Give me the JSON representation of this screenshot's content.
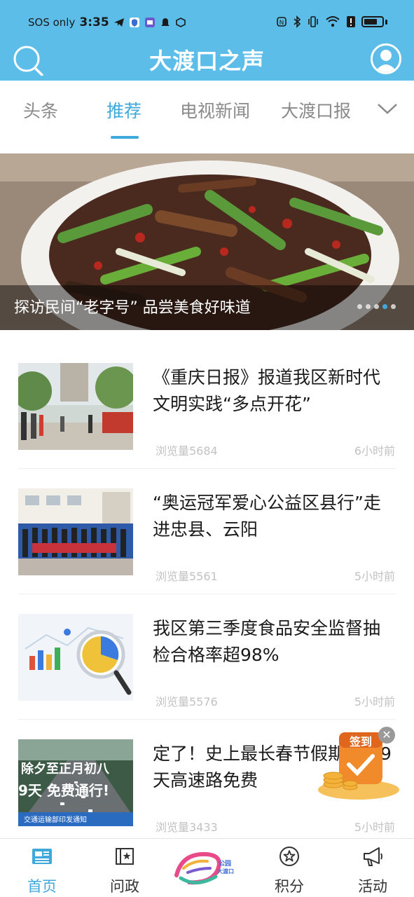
{
  "status_bar": {
    "carrier": "SOS only",
    "time": "3:35"
  },
  "header": {
    "title": "大渡口之声",
    "bg_color": "#5cbde9"
  },
  "tabs": {
    "items": [
      {
        "label": "头条",
        "active": false
      },
      {
        "label": "推荐",
        "active": true
      },
      {
        "label": "电视新闻",
        "active": false
      },
      {
        "label": "大渡口报",
        "active": false
      }
    ],
    "accent_color": "#3fa9dc"
  },
  "banner": {
    "caption": "探访民间“老字号” 品尝美食好味道",
    "slide_count": 5,
    "active_slide": 4
  },
  "news": [
    {
      "title": "《重庆日报》报道我区新时代文明实践“多点开花”",
      "views": "浏览量5684",
      "time": "6小时前",
      "thumb": "street-event-photo"
    },
    {
      "title": "“奥运冠军爱心公益区县行”走进忠县、云阳",
      "views": "浏览量5561",
      "time": "5小时前",
      "thumb": "group-photo"
    },
    {
      "title": "我区第三季度食品安全监督抽检合格率超98%",
      "views": "浏览量5576",
      "time": "5小时前",
      "thumb": "chart-magnifier-illustration"
    },
    {
      "title": "定了！史上最长春节假期连续9天高速路免费",
      "views": "浏览量3433",
      "time": "5小时前",
      "thumb": "highway-photo"
    }
  ],
  "news4_thumb_text": {
    "line1": "除夕至正月初八",
    "line2": "9天 免费通行!",
    "footer": "交通运输部印发通知"
  },
  "signin": {
    "label": "签到"
  },
  "bottom_nav": [
    {
      "label": "首页",
      "icon": "news-icon",
      "active": true
    },
    {
      "label": "问政",
      "icon": "book-star-icon",
      "active": false
    },
    {
      "label": "积分",
      "icon": "star-circle-icon",
      "active": false
    },
    {
      "label": "活动",
      "icon": "megaphone-icon",
      "active": false
    }
  ],
  "logo_text": {
    "line1": "公园",
    "line2": "大渡口"
  }
}
